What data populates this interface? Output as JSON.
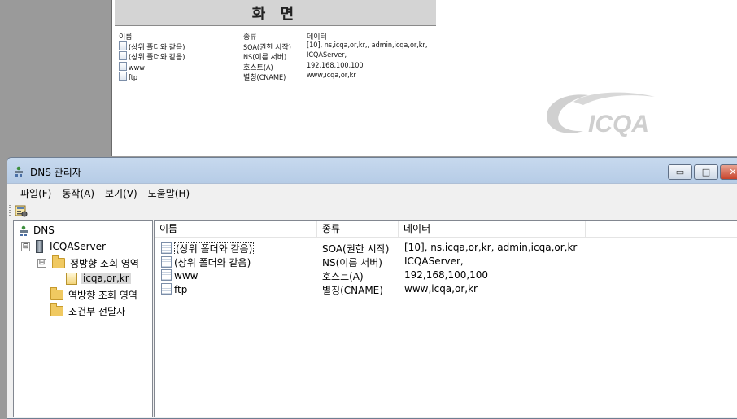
{
  "reference": {
    "title": "화 면",
    "headers": {
      "name": "이름",
      "type": "종류",
      "data": "데이터"
    },
    "rows": [
      {
        "name": "(상위 폴더와 같음)",
        "type": "SOA(권한 시작)",
        "data": "[10], ns,icqa,or,kr,, admin,icqa,or,kr,"
      },
      {
        "name": "(상위 폴더와 같음)",
        "type": "NS(이름 서버)",
        "data": "ICQAServer,"
      },
      {
        "name": "www",
        "type": "호스트(A)",
        "data": "192,168,100,100"
      },
      {
        "name": "ftp",
        "type": "별칭(CNAME)",
        "data": "www,icqa,or,kr"
      }
    ]
  },
  "logo": {
    "text": "ICQA",
    "color": "#d0d0d0"
  },
  "window": {
    "title": "DNS 관리자",
    "icon": "dns-manager-icon",
    "buttons": {
      "minimize": "minimize-icon",
      "maximize": "maximize-icon",
      "close": "close-icon"
    }
  },
  "menu": [
    {
      "label": "파일(F)"
    },
    {
      "label": "동작(A)"
    },
    {
      "label": "보기(V)"
    },
    {
      "label": "도움말(H)"
    }
  ],
  "toolbar": {
    "icon": "properties-icon"
  },
  "tree": {
    "root": "DNS",
    "server": "ICQAServer",
    "forward_zones": "정방향 조회 영역",
    "zone": "icqa,or,kr",
    "reverse_zones": "역방향 조회 영역",
    "conditional_forwarders": "조건부 전달자",
    "expanded_glyph": "⊟"
  },
  "list": {
    "headers": {
      "name": "이름",
      "type": "종류",
      "data": "데이터"
    },
    "rows": [
      {
        "name": "(상위 폴더와 같음)",
        "type": "SOA(권한 시작)",
        "data": "[10], ns,icqa,or,kr, admin,icqa,or,kr"
      },
      {
        "name": "(상위 폴더와 같음)",
        "type": "NS(이름 서버)",
        "data": "ICQAServer,"
      },
      {
        "name": "www",
        "type": "호스트(A)",
        "data": "192,168,100,100"
      },
      {
        "name": "ftp",
        "type": "별칭(CNAME)",
        "data": "www,icqa,or,kr"
      }
    ]
  },
  "colors": {
    "titlebar": "#c7d9ee",
    "folder": "#f0c961",
    "close_button": "#c7432b"
  }
}
